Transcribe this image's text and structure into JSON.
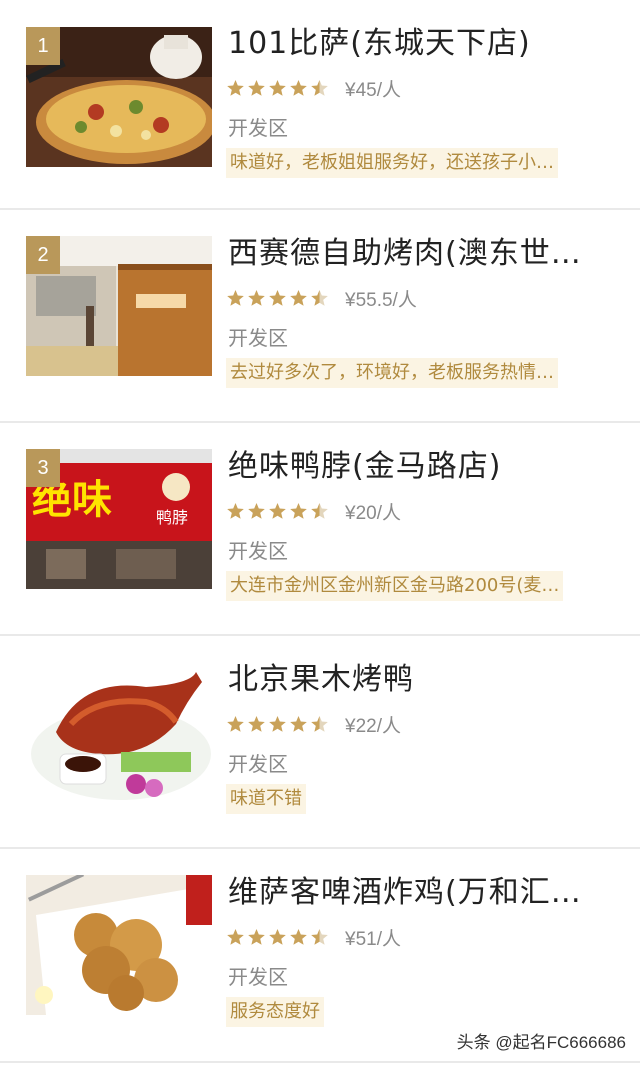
{
  "restaurants": [
    {
      "rank": "1",
      "name": "101比萨(东城天下店)",
      "rating": 4.5,
      "price": "¥45/人",
      "district": "开发区",
      "tag": "味道好，老板姐姐服务好，还送孩子小…",
      "image": "pizza"
    },
    {
      "rank": "2",
      "name": "西赛德自助烤肉(澳东世…",
      "rating": 4.5,
      "price": "¥55.5/人",
      "district": "开发区",
      "tag": "去过好多次了，环境好，老板服务热情…",
      "image": "restaurant-interior"
    },
    {
      "rank": "3",
      "name": "绝味鸭脖(金马路店)",
      "rating": 4.5,
      "price": "¥20/人",
      "district": "开发区",
      "tag": "大连市金州区金州新区金马路200号(麦…",
      "image": "storefront",
      "sign_text": "绝味",
      "sign_sub": "鸭脖"
    },
    {
      "rank": "",
      "name": "北京果木烤鸭",
      "rating": 4.5,
      "price": "¥22/人",
      "district": "开发区",
      "tag": "味道不错",
      "image": "roast-duck"
    },
    {
      "rank": "",
      "name": "维萨客啤酒炸鸡(万和汇…",
      "rating": 4.5,
      "price": "¥51/人",
      "district": "开发区",
      "tag": "服务态度好",
      "image": "fried-chicken"
    }
  ],
  "watermark": "头条 @起名FC666686",
  "colors": {
    "star": "#c9a25a",
    "tag_text": "#b08a3e",
    "tag_bg": "#fbf4e3",
    "rank_bg": "#b9985a"
  }
}
